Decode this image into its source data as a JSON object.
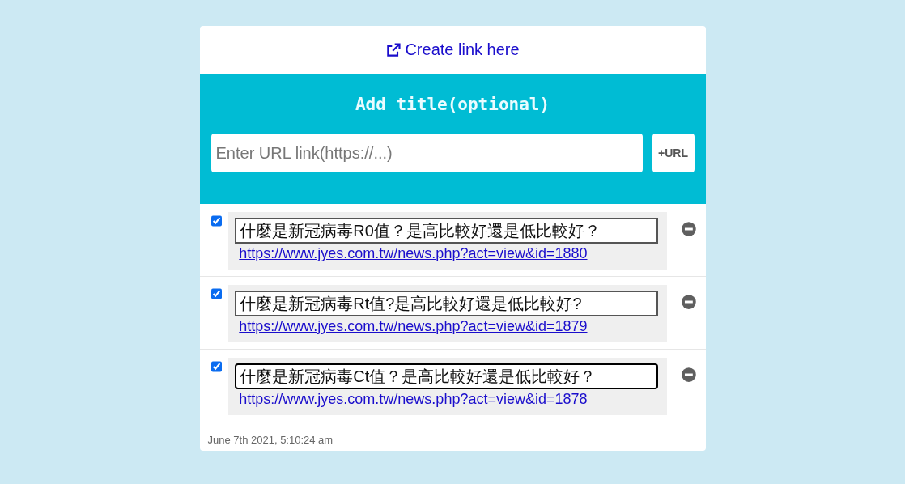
{
  "header": {
    "link": "Create link here"
  },
  "form": {
    "title": "Add title(optional)",
    "url_placeholder": "Enter URL link(https://...)",
    "add_button": "+URL"
  },
  "items": [
    {
      "checked": true,
      "title": "什麼是新冠病毒R0值？是高比較好還是低比較好？",
      "url": "https://www.jyes.com.tw/news.php?act=view&id=1880",
      "focused": false
    },
    {
      "checked": true,
      "title": "什麼是新冠病毒Rt值?是高比較好還是低比較好?",
      "url": "https://www.jyes.com.tw/news.php?act=view&id=1879",
      "focused": false
    },
    {
      "checked": true,
      "title": "什麼是新冠病毒Ct值？是高比較好還是低比較好？",
      "url": "https://www.jyes.com.tw/news.php?act=view&id=1878",
      "focused": true
    }
  ],
  "timestamp": "June 7th 2021, 5:10:24 am"
}
